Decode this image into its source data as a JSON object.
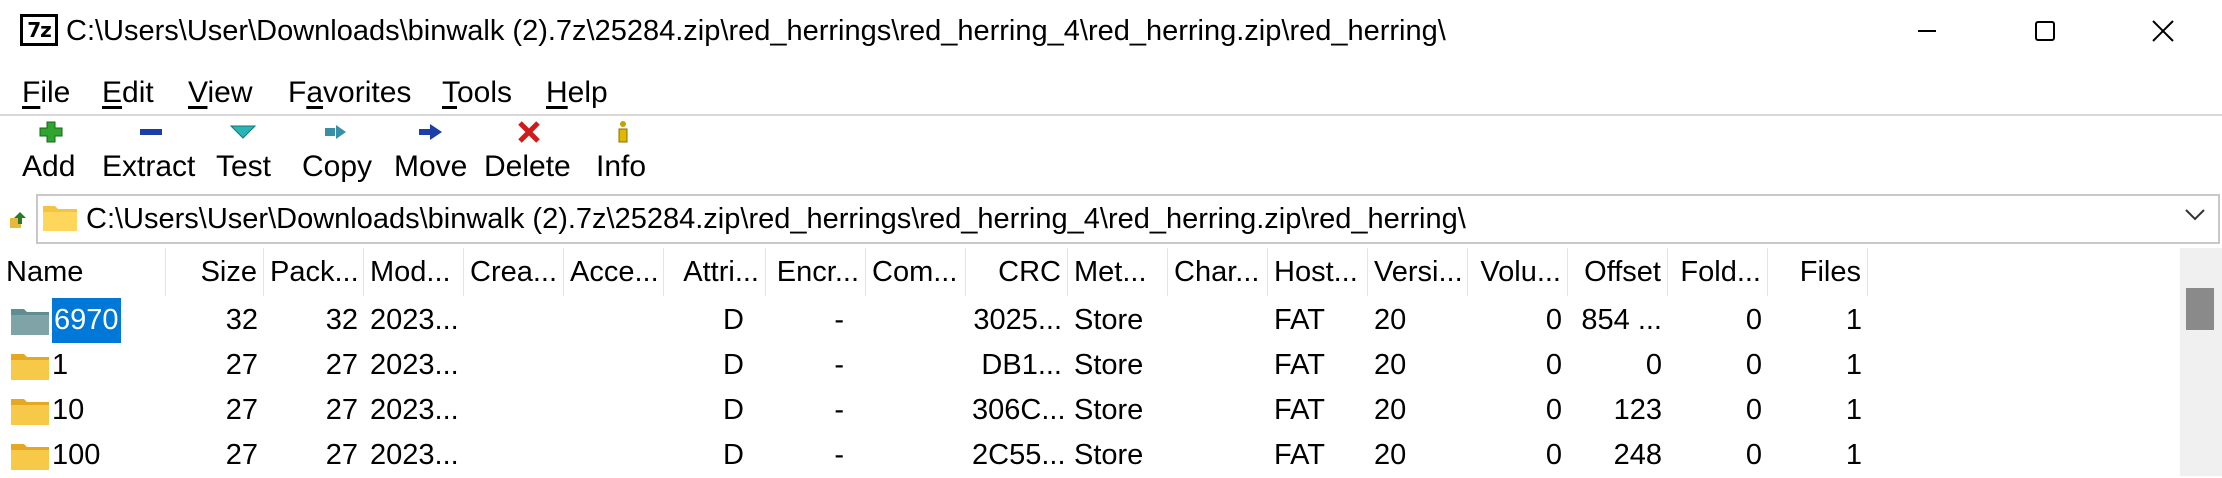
{
  "window": {
    "app_icon_text": "7z",
    "title": "C:\\Users\\User\\Downloads\\binwalk (2).7z\\25284.zip\\red_herrings\\red_herring_4\\red_herring.zip\\red_herring\\"
  },
  "menu": {
    "file": {
      "u": "F",
      "rest": "ile"
    },
    "edit": {
      "u": "E",
      "rest": "dit"
    },
    "view": {
      "u": "V",
      "rest": "iew"
    },
    "favorites": {
      "pre": "F",
      "u": "a",
      "rest": "vorites"
    },
    "tools": {
      "u": "T",
      "rest": "ools"
    },
    "help": {
      "u": "H",
      "rest": "elp"
    }
  },
  "toolbar": {
    "add": "Add",
    "extract": "Extract",
    "test": "Test",
    "copy": "Copy",
    "move": "Move",
    "delete": "Delete",
    "info": "Info"
  },
  "address": {
    "path": "C:\\Users\\User\\Downloads\\binwalk (2).7z\\25284.zip\\red_herrings\\red_herring_4\\red_herring.zip\\red_herring\\"
  },
  "columns": {
    "name": "Name",
    "size": "Size",
    "packed": "Pack...",
    "modified": "Mod...",
    "created": "Crea...",
    "accessed": "Acce...",
    "attributes": "Attri...",
    "encrypted": "Encr...",
    "comment": "Com...",
    "crc": "CRC",
    "method": "Met...",
    "characteristics": "Char...",
    "host_os": "Host...",
    "version": "Versi...",
    "volume": "Volu...",
    "offset": "Offset",
    "folders": "Fold...",
    "files": "Files"
  },
  "rows": [
    {
      "name": "6970",
      "size": "32",
      "packed": "32",
      "modified": "2023...",
      "created": "",
      "accessed": "",
      "attributes": "D",
      "encrypted": "-",
      "comment": "",
      "crc": "3025...",
      "method": "Store",
      "characteristics": "",
      "host_os": "FAT",
      "version": "20",
      "volume": "0",
      "offset": "854 ...",
      "folders": "0",
      "files": "1"
    },
    {
      "name": "1",
      "size": "27",
      "packed": "27",
      "modified": "2023...",
      "created": "",
      "accessed": "",
      "attributes": "D",
      "encrypted": "-",
      "comment": "",
      "crc": "DB1...",
      "method": "Store",
      "characteristics": "",
      "host_os": "FAT",
      "version": "20",
      "volume": "0",
      "offset": "0",
      "folders": "0",
      "files": "1"
    },
    {
      "name": "10",
      "size": "27",
      "packed": "27",
      "modified": "2023...",
      "created": "",
      "accessed": "",
      "attributes": "D",
      "encrypted": "-",
      "comment": "",
      "crc": "306C...",
      "method": "Store",
      "characteristics": "",
      "host_os": "FAT",
      "version": "20",
      "volume": "0",
      "offset": "123",
      "folders": "0",
      "files": "1"
    },
    {
      "name": "100",
      "size": "27",
      "packed": "27",
      "modified": "2023...",
      "created": "",
      "accessed": "",
      "attributes": "D",
      "encrypted": "-",
      "comment": "",
      "crc": "2C55...",
      "method": "Store",
      "characteristics": "",
      "host_os": "FAT",
      "version": "20",
      "volume": "0",
      "offset": "248",
      "folders": "0",
      "files": "1"
    }
  ],
  "selected_row": 0,
  "colors": {
    "selection": "#0078d7",
    "folder": "#f5c342",
    "folder_selected": "#7fa3a6"
  }
}
